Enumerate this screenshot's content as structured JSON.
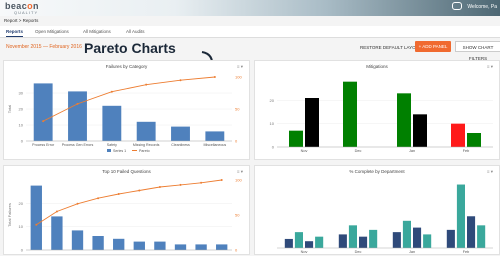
{
  "header": {
    "logo_main": "beac",
    "logo_o": "o",
    "logo_end": "n",
    "logo_sub": "QUALITY",
    "welcome": "Welcome, Pa"
  },
  "breadcrumb": "Report > Reports",
  "tabs": [
    {
      "label": "Reports"
    },
    {
      "label": "Open Mitigations"
    },
    {
      "label": "All Mitigations"
    },
    {
      "label": "All Audits"
    }
  ],
  "toolbar": {
    "date_range": "November 2015 — February 2016",
    "overlay_title": "Pareto Charts",
    "restore": "RESTORE DEFAULT LAYOUT",
    "add_panel": "+ ADD PANEL",
    "show_filters": "SHOW CHART FILTERS"
  },
  "panels": {
    "menu_label": "≡ ▾",
    "p1_title": "Failures by Category",
    "p2_title": "Mitigations",
    "p3_title": "Top 10 Failed Questions",
    "p4_title": "% Complete by Department"
  },
  "colors": {
    "bar_blue": "#4f81bd",
    "line_orange": "#ed7d31",
    "green": "#008000",
    "red": "#ff1a1a",
    "teal": "#3aa89c",
    "navy": "#2f4a7a"
  },
  "chart_data": [
    {
      "type": "bar",
      "title": "Failures by Category",
      "categories": [
        "Process Error",
        "Process Gen Errors",
        "Safety",
        "Missing Records",
        "Cleanliness",
        "Miscellaneous"
      ],
      "series": [
        {
          "name": "Series 1",
          "values": [
            36,
            31,
            22,
            12,
            9,
            6
          ]
        },
        {
          "name": "Pareto",
          "values": [
            31,
            58,
            77,
            88,
            95,
            100
          ]
        }
      ],
      "y_ticks": [
        "0",
        "10",
        "20",
        "30"
      ],
      "y2_ticks": [
        "0",
        "50",
        "100"
      ],
      "ylabel": "Total",
      "ylim": [
        0,
        40
      ],
      "y2lim": [
        0,
        100
      ]
    },
    {
      "type": "bar",
      "title": "Mitigations",
      "categories": [
        "Nov",
        "Dec",
        "Jan",
        "Feb"
      ],
      "values": [
        [
          7,
          21
        ],
        [
          28,
          0
        ],
        [
          23,
          14
        ],
        [
          10,
          6
        ]
      ],
      "y_ticks": [
        "0",
        "10",
        "20"
      ],
      "ylim": [
        0,
        30
      ]
    },
    {
      "type": "bar",
      "title": "Top 10 Failed Questions",
      "categories": [
        "1",
        "2",
        "3",
        "4",
        "5",
        "6",
        "7",
        "8",
        "9",
        "10"
      ],
      "series": [
        {
          "name": "Series 1",
          "values": [
            23,
            12,
            7,
            5,
            4,
            3,
            3,
            2,
            2,
            2
          ]
        },
        {
          "name": "Pareto",
          "values": [
            36,
            55,
            66,
            74,
            80,
            85,
            90,
            93,
            96,
            100
          ]
        }
      ],
      "y_ticks": [
        "0",
        "10",
        "20"
      ],
      "y2_ticks": [
        "0",
        "50",
        "100"
      ],
      "ylabel": "Total Failures",
      "ylim": [
        0,
        25
      ],
      "y2lim": [
        0,
        100
      ]
    },
    {
      "type": "bar",
      "title": "% Complete by Department",
      "categories": [
        "Nov",
        "Dec",
        "Jan",
        "Feb"
      ],
      "values": [
        [
          4,
          7,
          3,
          5
        ],
        [
          6,
          10,
          5,
          8
        ],
        [
          7,
          12,
          9,
          6
        ],
        [
          8,
          28,
          14,
          10
        ]
      ],
      "ylim": [
        0,
        30
      ]
    }
  ]
}
